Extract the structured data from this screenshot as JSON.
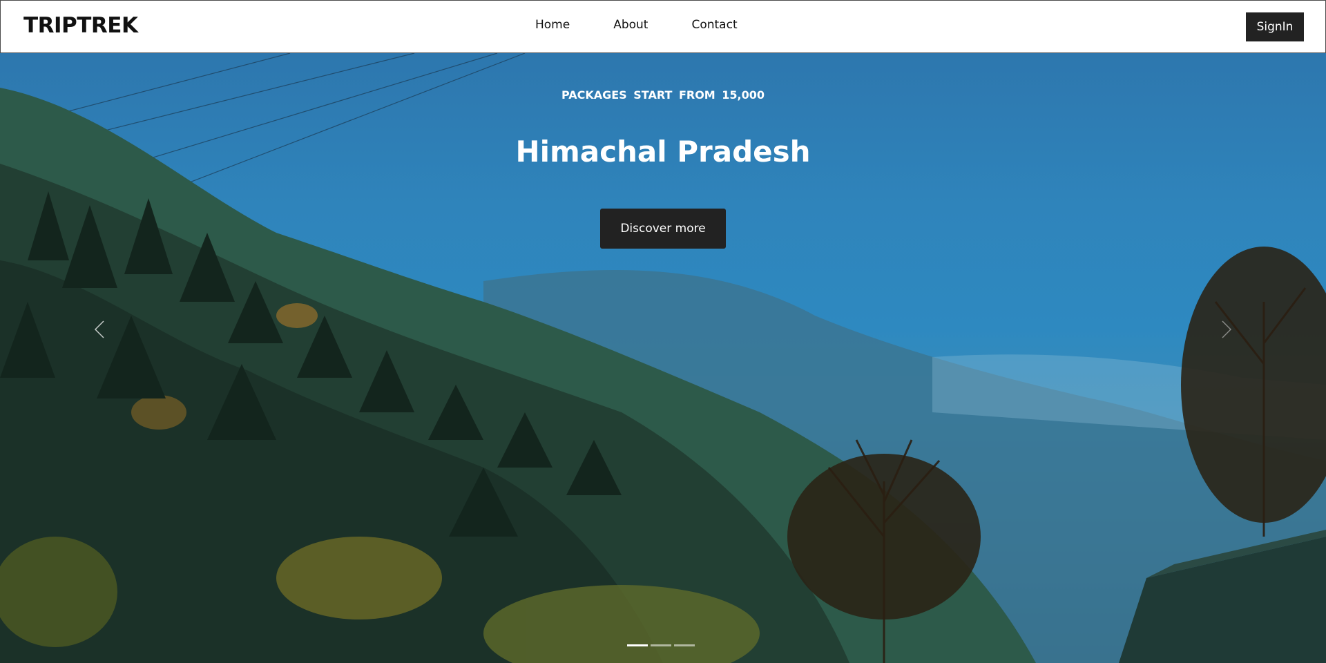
{
  "navbar": {
    "brand": "TRIPTREK",
    "links": [
      {
        "label": "Home"
      },
      {
        "label": "About"
      },
      {
        "label": "Contact"
      }
    ],
    "signin_label": "SignIn"
  },
  "hero": {
    "tagline": "PACKAGES START FROM 15,000",
    "title": "Himachal Pradesh",
    "cta_label": "Discover more",
    "prev_icon": "chevron-left-icon",
    "next_icon": "chevron-right-icon",
    "slides_total": 3,
    "active_slide": 1
  }
}
